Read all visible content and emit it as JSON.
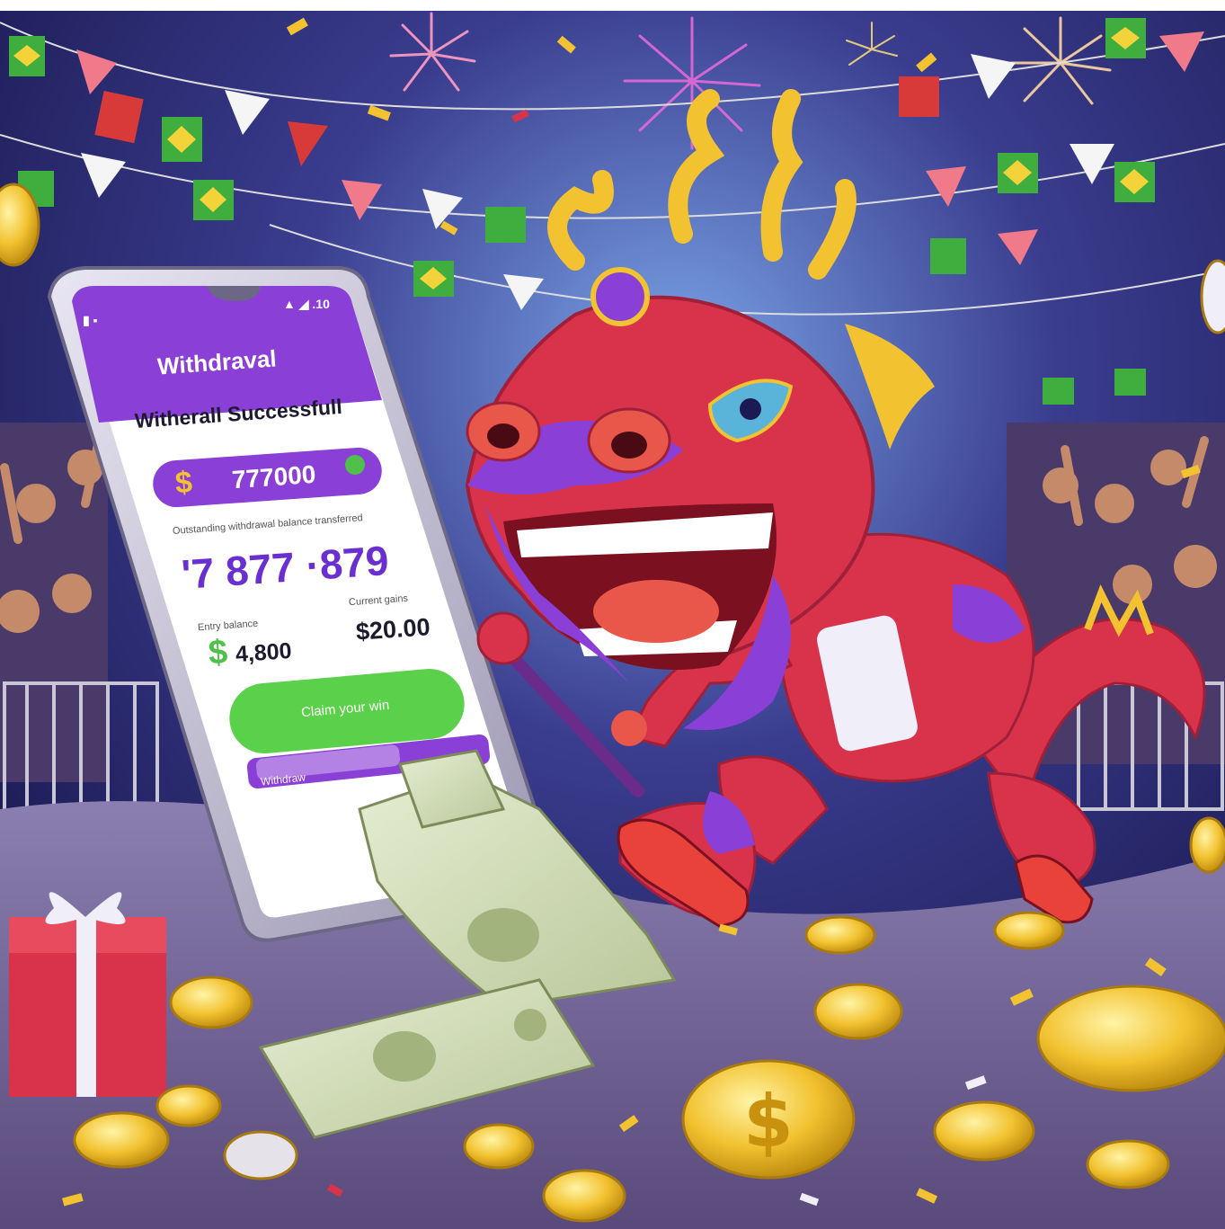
{
  "phone": {
    "status_bar_left": "▮ ▪",
    "status_bar_right": "▲ ◢ .10",
    "header_title": "Withdraval",
    "success_title": "Witherall Successfull",
    "amount_currency": "$",
    "amount_value": "777000",
    "fine_print": "Outstanding withdrawal balance transferred",
    "big_number": "'7 877 ·879",
    "left_caption": "Entry balance",
    "right_caption": "Current gains",
    "left_currency": "$",
    "left_value": "4,800",
    "right_value": "$20.00",
    "cta_label": "Claim your win",
    "bottom_chip": "Withdraw"
  },
  "colors": {
    "night_sky": "#1f1d5e",
    "stage_floor": "#6b5b8e",
    "phone_purple": "#8a3fd6",
    "cta_green": "#5bd04a",
    "coin_gold": "#f2c230",
    "dragon_red": "#d8334a"
  }
}
